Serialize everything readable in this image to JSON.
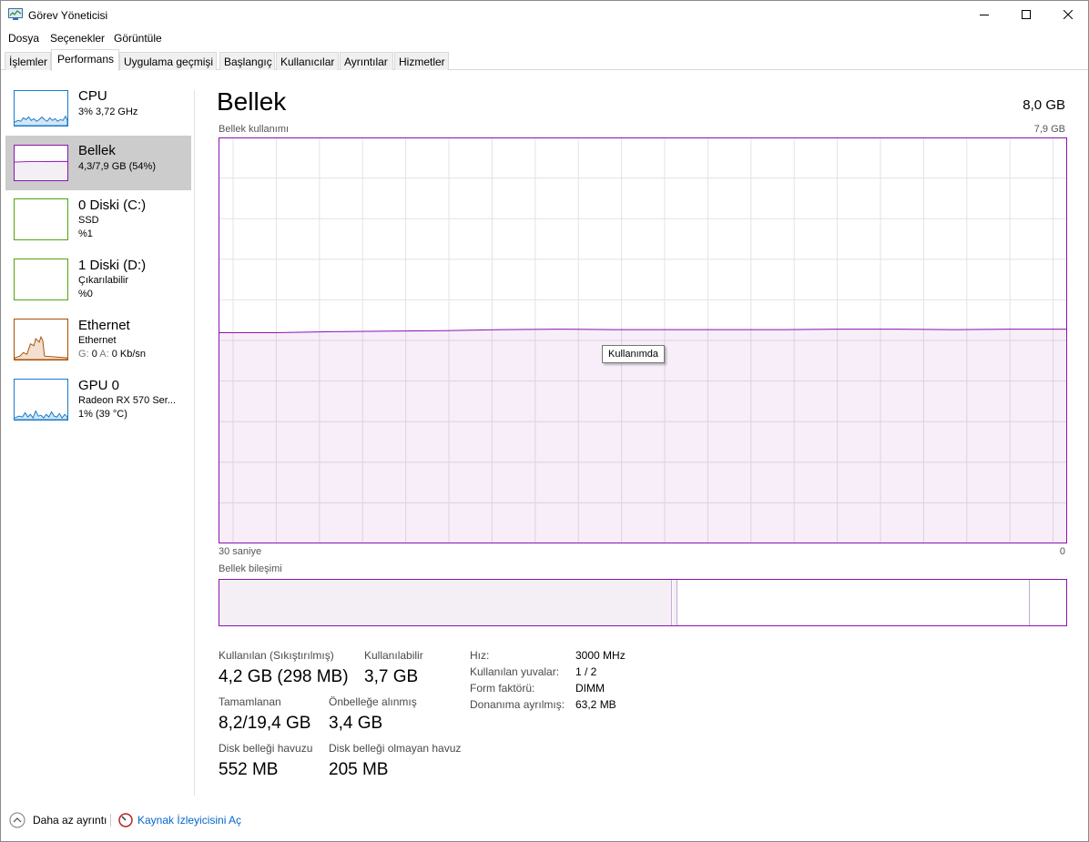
{
  "window": {
    "title": "Görev Yöneticisi"
  },
  "menu": [
    "Dosya",
    "Seçenekler",
    "Görüntüle"
  ],
  "tabs": [
    "İşlemler",
    "Performans",
    "Uygulama geçmişi",
    "Başlangıç",
    "Kullanıcılar",
    "Ayrıntılar",
    "Hizmetler"
  ],
  "active_tab": "Performans",
  "sidebar": {
    "items": [
      {
        "title": "CPU",
        "line1": "3% 3,72 GHz",
        "line2": "",
        "line3": "",
        "color": "#1979ca",
        "selected": false
      },
      {
        "title": "Bellek",
        "line1": "4,3/7,9 GB (54%)",
        "line2": "",
        "line3": "",
        "color": "#8b12ae",
        "selected": true
      },
      {
        "title": "0 Diski (C:)",
        "line1": "SSD",
        "line2": "%1",
        "line3": "",
        "color": "#4da60c",
        "selected": false
      },
      {
        "title": "1 Diski (D:)",
        "line1": "Çıkarılabilir",
        "line2": "%0",
        "line3": "",
        "color": "#4da60c",
        "selected": false
      },
      {
        "title": "Ethernet",
        "line1": "Ethernet",
        "line2": "",
        "line3": "",
        "color": "#a74f01",
        "selected": false
      },
      {
        "title": "GPU 0",
        "line1": "Radeon RX 570 Ser...",
        "line2": "1% (39 °C)",
        "line3": "",
        "color": "#1979ca",
        "selected": false
      }
    ],
    "ethernet_stats": {
      "g_label": "G:",
      "g_value": "0",
      "a_label": "A:",
      "a_value": "0 Kb/sn"
    }
  },
  "main": {
    "title": "Bellek",
    "total": "8,0 GB",
    "usage_label": "Bellek kullanımı",
    "usage_max": "7,9 GB",
    "axis_left": "30 saniye",
    "axis_right": "0",
    "tooltip": "Kullanımda",
    "composition_label": "Bellek bileşimi",
    "accent_color": "#8b12ae"
  },
  "stats": {
    "in_use_label": "Kullanılan (Sıkıştırılmış)",
    "in_use_value": "4,2 GB (298 MB)",
    "available_label": "Kullanılabilir",
    "available_value": "3,7 GB",
    "committed_label": "Tamamlanan",
    "committed_value": "8,2/19,4 GB",
    "cached_label": "Önbelleğe alınmış",
    "cached_value": "3,4 GB",
    "paged_label": "Disk belleği havuzu",
    "paged_value": "552 MB",
    "nonpaged_label": "Disk belleği olmayan havuz",
    "nonpaged_value": "205 MB"
  },
  "details": [
    {
      "key": "Hız:",
      "value": "3000 MHz"
    },
    {
      "key": "Kullanılan yuvalar:",
      "value": "1 / 2"
    },
    {
      "key": "Form faktörü:",
      "value": "DIMM"
    },
    {
      "key": "Donanıma ayrılmış:",
      "value": "63,2 MB"
    }
  ],
  "footer": {
    "fewer_details": "Daha az ayrıntı",
    "open_monitor": "Kaynak İzleyicisini Aç"
  },
  "chart_data": {
    "type": "area",
    "title": "Bellek kullanımı",
    "x": [
      30,
      28,
      26,
      24,
      22,
      20,
      18,
      16,
      14,
      12,
      10,
      8,
      6,
      4,
      2,
      0
    ],
    "values": [
      4.1,
      4.1,
      4.12,
      4.13,
      4.14,
      4.16,
      4.17,
      4.16,
      4.16,
      4.16,
      4.16,
      4.17,
      4.17,
      4.16,
      4.17,
      4.17
    ],
    "xlabel": "",
    "ylabel": "",
    "xlim": [
      30,
      0
    ],
    "ylim": [
      0,
      7.9
    ]
  }
}
